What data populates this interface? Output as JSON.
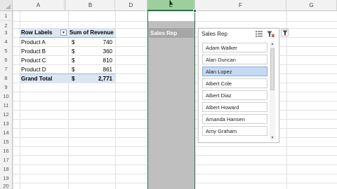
{
  "sheet": {
    "columns": [
      "A",
      "B",
      "C",
      "D",
      "E",
      "F",
      "G"
    ],
    "selected_column": "E",
    "rows": [
      "1",
      "2",
      "3",
      "4",
      "5",
      "6",
      "7",
      "8",
      "9",
      "10",
      "11",
      "12",
      "13",
      "14",
      "15",
      "16",
      "17",
      "18",
      "19",
      "20"
    ]
  },
  "pivot": {
    "header_row_labels": "Row Labels",
    "header_sum_revenue": "Sum of Revenue",
    "rows": [
      {
        "label": "Product A",
        "currency": "$",
        "value": "740"
      },
      {
        "label": "Product B",
        "currency": "$",
        "value": "360"
      },
      {
        "label": "Product C",
        "currency": "$",
        "value": "810"
      },
      {
        "label": "Product D",
        "currency": "$",
        "value": "861"
      }
    ],
    "total": {
      "label": "Grand Total",
      "currency": "$",
      "value": "2,771"
    }
  },
  "cell_e3": "Sales Rep",
  "slicer": {
    "title": "Sales Rep",
    "items": [
      "Adam Walker",
      "Alan Duncan",
      "Alan Lopez",
      "Albert Cole",
      "Albert Diaz",
      "Albert Howard",
      "Amanda Hansen",
      "Amy Graham"
    ],
    "selected_item": "Alan Lopez"
  },
  "colors": {
    "accent": "#217346",
    "selected_column_fill": "#bfbfbf",
    "pivot_header_fill": "#dce6f1",
    "slicer_selected_fill": "#c5d9f1"
  },
  "icons": [
    "multi-select-icon",
    "clear-filter-icon",
    "filter-icon",
    "dropdown-arrow-icon"
  ]
}
